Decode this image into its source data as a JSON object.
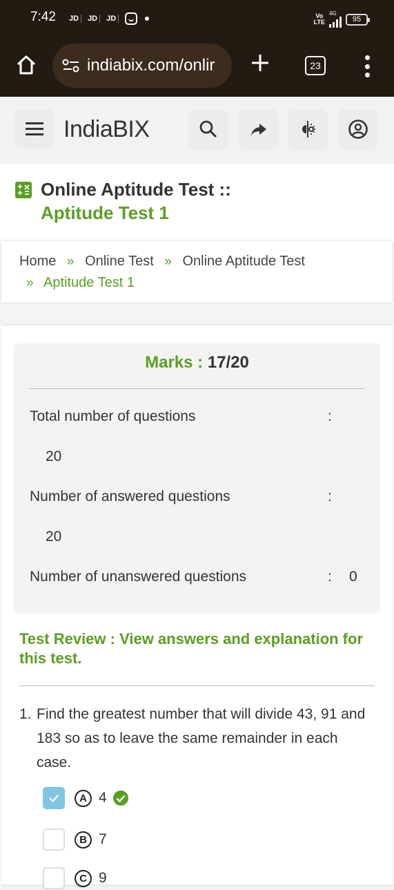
{
  "status_bar": {
    "time": "7:42",
    "apps": [
      "JD",
      "JD",
      "JD"
    ],
    "network_label_top": "Vo",
    "network_label_bottom": "LTE",
    "network_type": "4G",
    "battery": "95"
  },
  "browser": {
    "url": "indiabix.com/onlir",
    "tab_count": "23"
  },
  "site": {
    "brand": "IndiaBIX",
    "icons": [
      "menu-icon",
      "search-icon",
      "share-icon",
      "theme-toggle-icon",
      "account-icon"
    ]
  },
  "page": {
    "title_prefix": "Online Aptitude Test ::",
    "title_highlight": "Aptitude Test 1",
    "breadcrumb": {
      "sep": "»",
      "items": [
        "Home",
        "Online Test",
        "Online Aptitude Test",
        "Aptitude Test 1"
      ]
    }
  },
  "result": {
    "marks_label": "Marks :",
    "marks_value": "17/20",
    "stats": [
      {
        "label": "Total number of questions",
        "colon": ":",
        "value": "20"
      },
      {
        "label": "Number of answered questions",
        "colon": ":",
        "value": "20"
      },
      {
        "label": "Number of unanswered questions",
        "colon": ":",
        "value": "0"
      }
    ]
  },
  "review": {
    "link_text": "Test Review : View answers and explanation for this test."
  },
  "question": {
    "number": "1.",
    "text": "Find the greatest number that will divide 43, 91 and 183 so as to leave the same remainder in each case.",
    "options": [
      {
        "letter": "A",
        "text": "4",
        "selected": true,
        "correct": true
      },
      {
        "letter": "B",
        "text": "7",
        "selected": false,
        "correct": false
      },
      {
        "letter": "C",
        "text": "9",
        "selected": false,
        "correct": false
      }
    ]
  },
  "colors": {
    "accent_green": "#5a9f22",
    "browser_bar": "#231a12",
    "checkbox_selected": "#7fc6e2"
  }
}
